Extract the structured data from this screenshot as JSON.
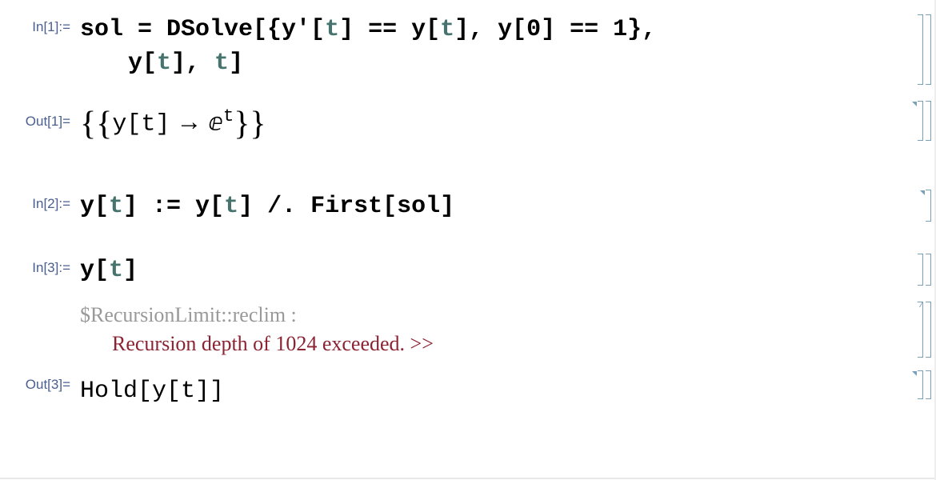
{
  "cells": {
    "in1": {
      "label": "In[1]:=",
      "line1_a": "sol = DSolve[{y'[",
      "line1_t": "t",
      "line1_b": "] == y[",
      "line1_t2": "t",
      "line1_c": "], y[0] == 1},",
      "line2_a": "y[",
      "line2_t": "t",
      "line2_b": "], ",
      "line2_t2": "t",
      "line2_c": "]"
    },
    "out1": {
      "label": "Out[1]=",
      "brace_l": "{{",
      "y_part": "y[t]",
      "arrow": " → ",
      "e_base": "ⅇ",
      "e_sup": "t",
      "brace_r": "}}"
    },
    "in2": {
      "label": "In[2]:=",
      "a": "y[",
      "t1": "t",
      "b": "] := y[",
      "t2": "t",
      "c": "] /. First[sol]"
    },
    "in3": {
      "label": "In[3]:=",
      "a": "y[",
      "t": "t",
      "b": "]"
    },
    "msg": {
      "name": "$RecursionLimit::reclim :",
      "text": "Recursion depth of 1024 exceeded. ",
      "link": ">>"
    },
    "out3": {
      "label": "Out[3]=",
      "content": "Hold[y[t]]"
    }
  }
}
